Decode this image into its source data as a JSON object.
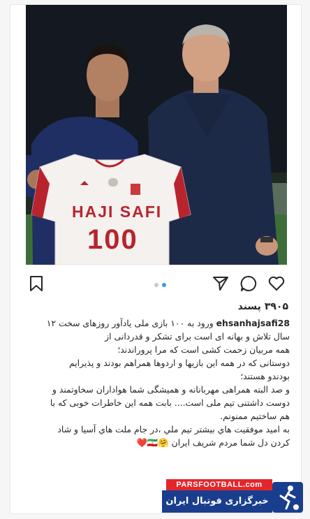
{
  "post": {
    "photo": {
      "jersey_name": "HAJI SAFI",
      "jersey_number": "100"
    },
    "actions": {
      "bookmark": "bookmark-icon",
      "share": "send-icon",
      "comment": "comment-icon",
      "like": "heart-icon"
    },
    "carousel": {
      "count": 2,
      "active": 2
    },
    "likes": "۳۹۰۵ پسند",
    "caption": {
      "username": "ehsanhajsafi28",
      "lines": [
        "ورود به ۱۰۰ بازی ملی یادآور روزهای سخت ۱۲",
        "سال تلاش و بهانه ای است برای تشکر و قدردانی از",
        "همه مربیان زحمت کشی است که مرا پروراندند؛",
        "دوستانی که در همه این بازیها و اردوها همراهم بودند و پذیرایم",
        "بودندو هستند؛",
        "و صد البته همراهی مهربانانه و همیشگی شما هواداران سخاوتمند و",
        "دوست داشتنی تیم ملی است.... بابت همه این خاطرات خوبی که با",
        "هم ساختیم ممنونم.",
        "به امید موفقیت هاي بيشتر تيم ملي ،در جام ملت هاي آسيا و شاد",
        "کردن دل شما مردم شریف ایران 🤗🇮🇷❤️"
      ]
    }
  },
  "watermark": {
    "site": "PARSFOOTBALL.com",
    "tagline": "خبرگزاری فوتبال ایران"
  },
  "colors": {
    "accent_blue": "#3897f0",
    "badge_red": "#e4262c",
    "badge_blue": "#1a3e8e"
  }
}
